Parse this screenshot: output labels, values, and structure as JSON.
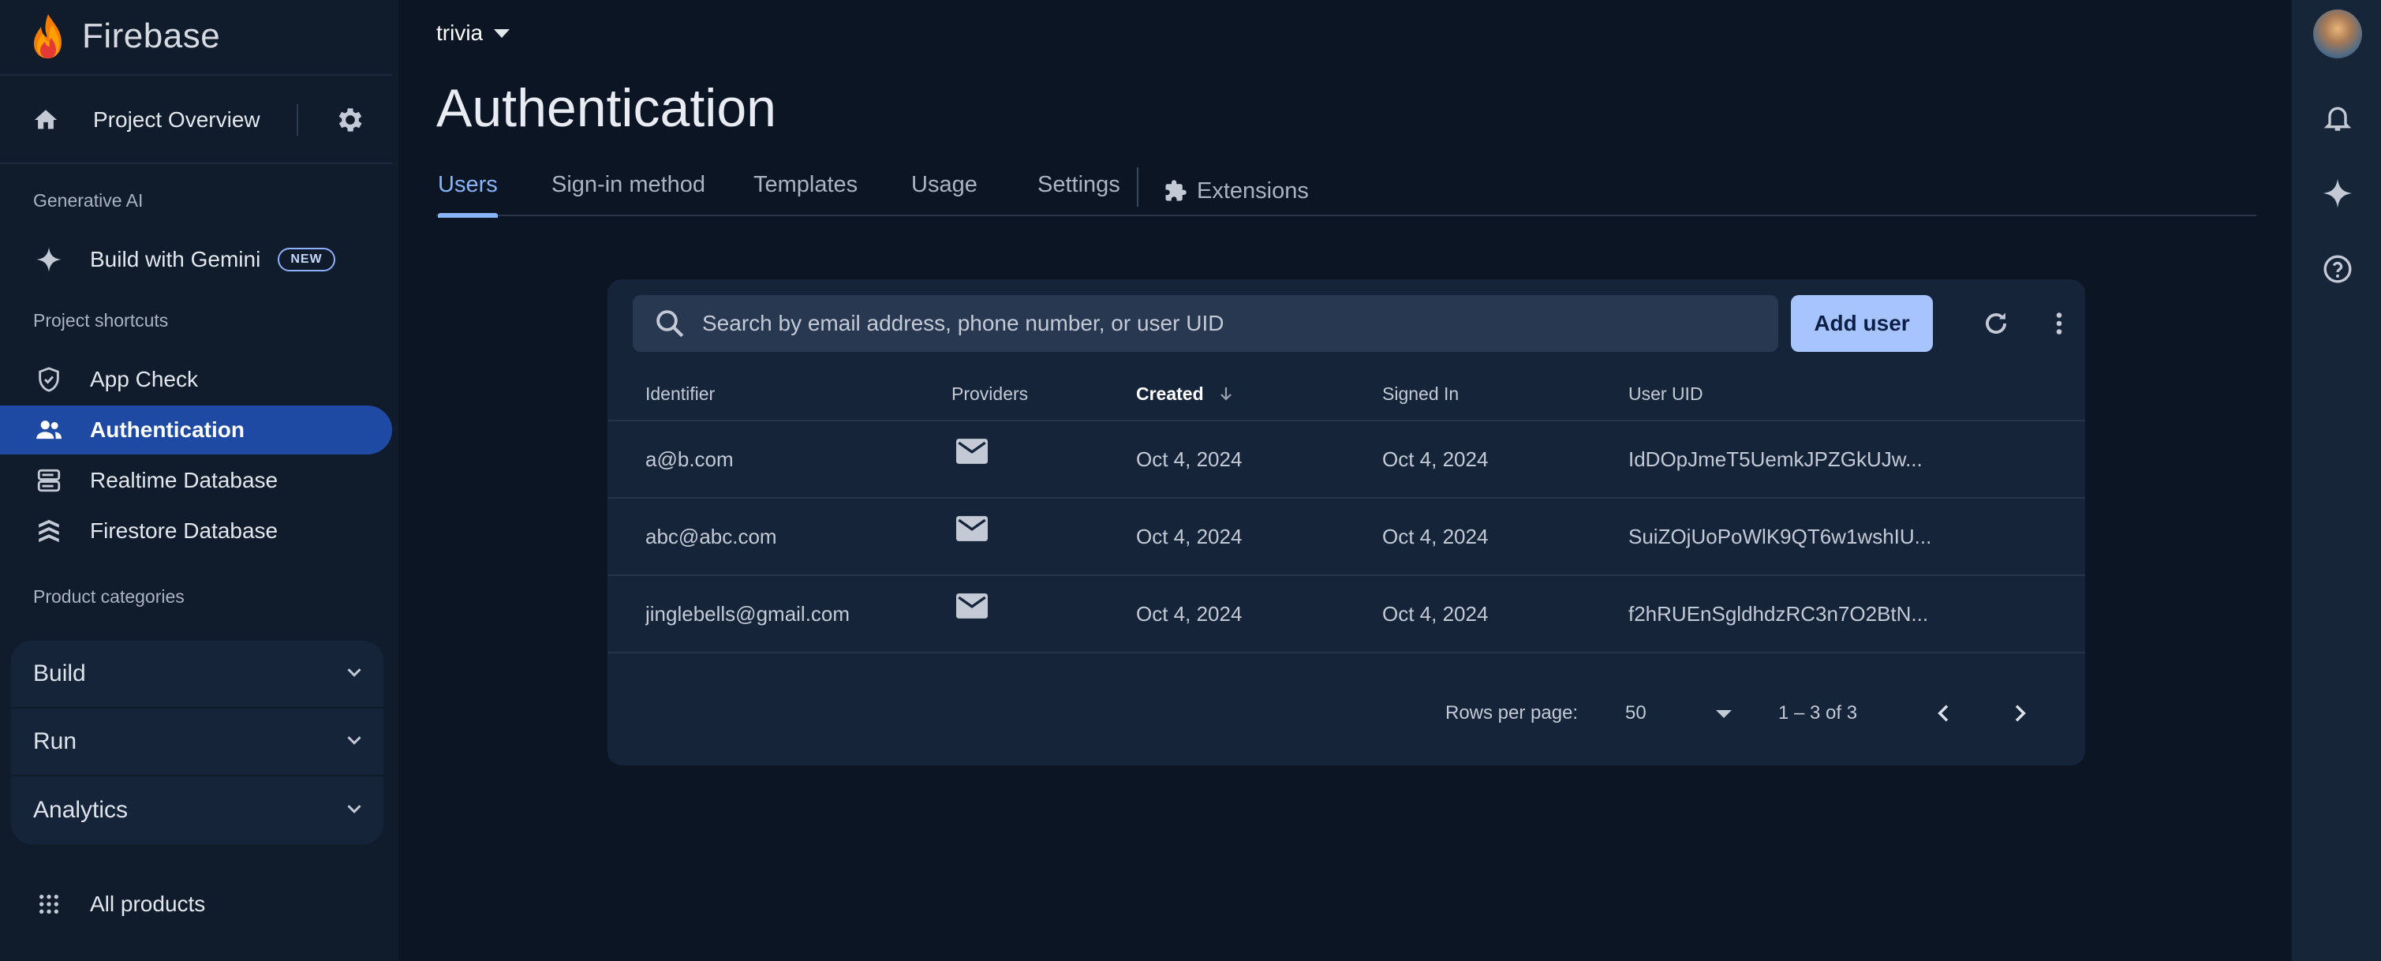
{
  "brand": {
    "name": "Firebase"
  },
  "sidebar": {
    "project_overview": "Project Overview",
    "section_generative_ai": "Generative AI",
    "build_with_gemini": "Build with Gemini",
    "badge_new": "NEW",
    "section_shortcuts": "Project shortcuts",
    "shortcuts": [
      {
        "label": "App Check",
        "icon": "shield-check-icon"
      },
      {
        "label": "Authentication",
        "icon": "people-icon",
        "active": true
      },
      {
        "label": "Realtime Database",
        "icon": "database-icon"
      },
      {
        "label": "Firestore Database",
        "icon": "firestore-icon"
      }
    ],
    "section_categories": "Product categories",
    "categories": [
      "Build",
      "Run",
      "Analytics"
    ],
    "all_products": "All products"
  },
  "header": {
    "project": "trivia",
    "title": "Authentication"
  },
  "tabs": [
    "Users",
    "Sign-in method",
    "Templates",
    "Usage",
    "Settings",
    "Extensions"
  ],
  "users": {
    "search_placeholder": "Search by email address, phone number, or user UID",
    "add_user": "Add user",
    "columns": [
      "Identifier",
      "Providers",
      "Created",
      "Signed In",
      "User UID"
    ],
    "rows": [
      {
        "identifier": "a@b.com",
        "provider": "email-icon",
        "created": "Oct 4, 2024",
        "signed_in": "Oct 4, 2024",
        "uid": "IdDOpJmeT5UemkJPZGkUJw..."
      },
      {
        "identifier": "abc@abc.com",
        "provider": "email-icon",
        "created": "Oct 4, 2024",
        "signed_in": "Oct 4, 2024",
        "uid": "SuiZOjUoPoWlK9QT6w1wshIU..."
      },
      {
        "identifier": "jinglebells@gmail.com",
        "provider": "email-icon",
        "created": "Oct 4, 2024",
        "signed_in": "Oct 4, 2024",
        "uid": "f2hRUEnSgldhdzRC3n7O2BtN..."
      }
    ],
    "rows_per_page_label": "Rows per page:",
    "rows_per_page": "50",
    "range": "1 – 3 of 3"
  },
  "colors": {
    "accent": "#8ab4f8",
    "active_nav": "#1f4aa3",
    "primary_button": "#a8c4ff"
  }
}
